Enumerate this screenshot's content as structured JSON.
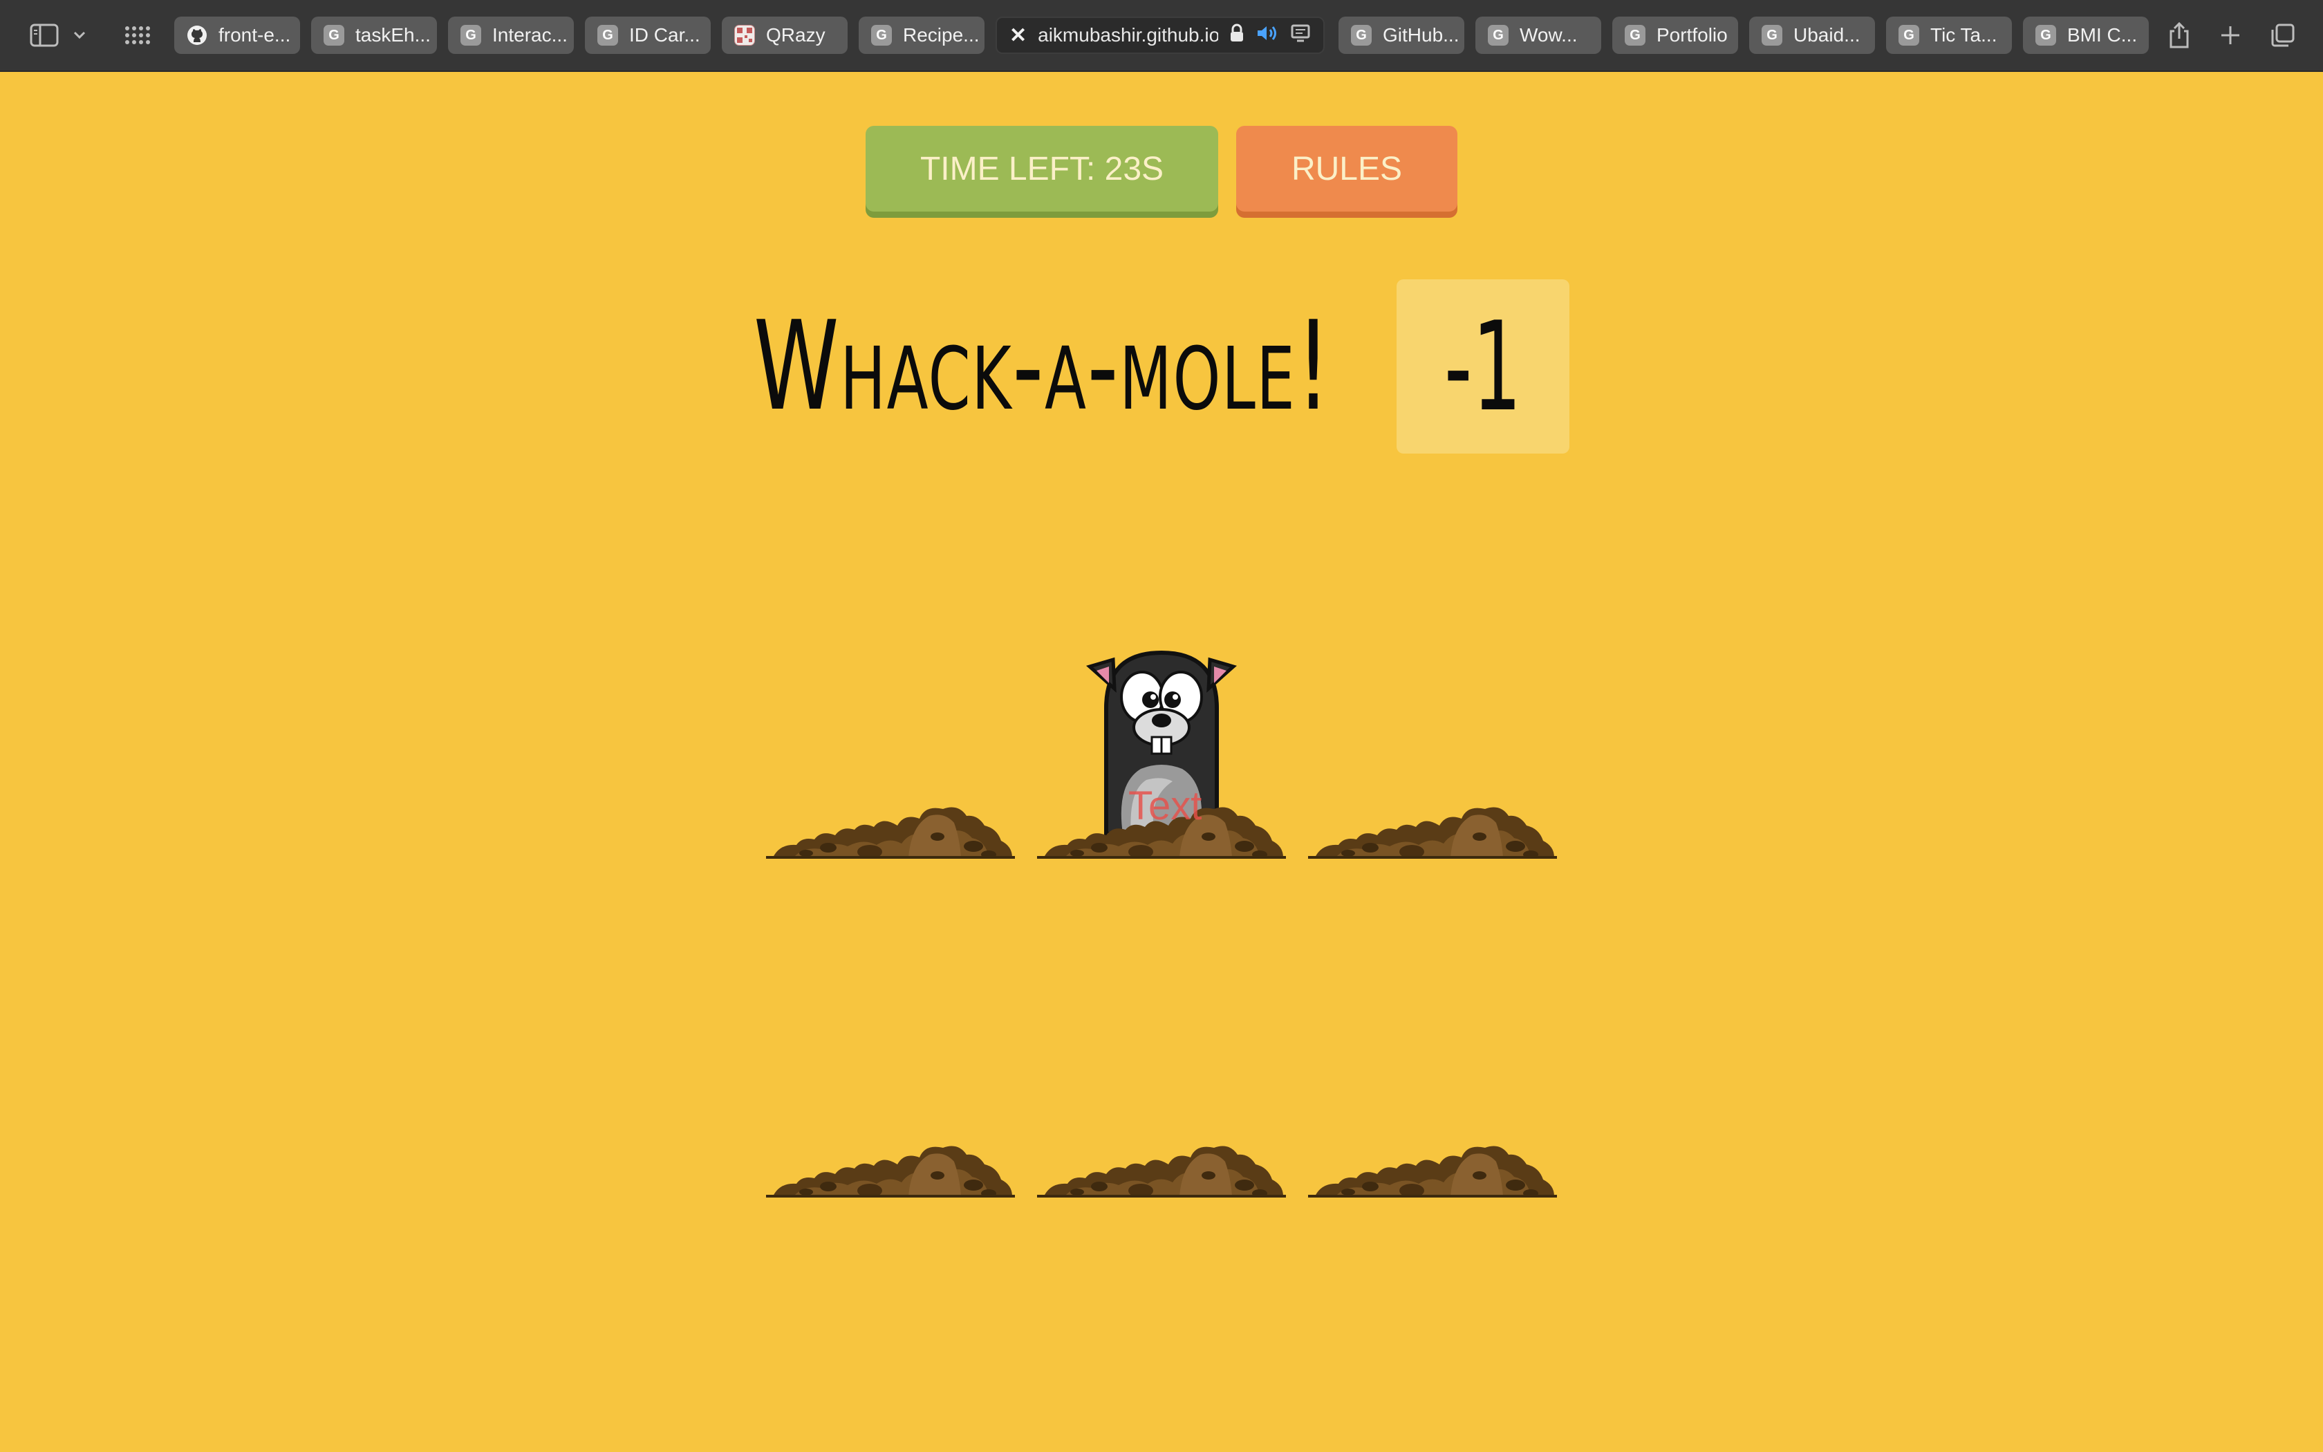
{
  "browser": {
    "tabs": [
      {
        "label": "front-e...",
        "icon": "github-icon"
      },
      {
        "label": "taskEh...",
        "icon": "letter-g-icon"
      },
      {
        "label": "Interac...",
        "icon": "letter-g-icon"
      },
      {
        "label": "ID Car...",
        "icon": "letter-g-icon"
      },
      {
        "label": "QRazy",
        "icon": "qr-favicon-icon"
      },
      {
        "label": "Recipe...",
        "icon": "letter-g-icon"
      },
      {
        "label": "aikmubashir.github.io",
        "icon": "close-icon",
        "active": true
      },
      {
        "label": "GitHub...",
        "icon": "letter-g-icon"
      },
      {
        "label": "Wow...",
        "icon": "letter-g-icon"
      },
      {
        "label": "Portfolio",
        "icon": "letter-g-icon"
      },
      {
        "label": "Ubaid...",
        "icon": "letter-g-icon"
      },
      {
        "label": "Tic Ta...",
        "icon": "letter-g-icon"
      },
      {
        "label": "BMI C...",
        "icon": "letter-g-icon"
      }
    ],
    "favicon_letter": "G",
    "close_glyph": "✕"
  },
  "game": {
    "timer_label": "TIME LEFT: 23S",
    "rules_label": "RULES",
    "title": "Whack-a-mole!",
    "score": "-1",
    "mole_label": "Text",
    "active_hole": 2,
    "hole_count": 6
  },
  "colors": {
    "background": "#f7c53f",
    "timer": "#9cba55",
    "rules": "#ef8a4d",
    "score_box": "#f8d56e",
    "dirt": "#6b4a1f"
  }
}
